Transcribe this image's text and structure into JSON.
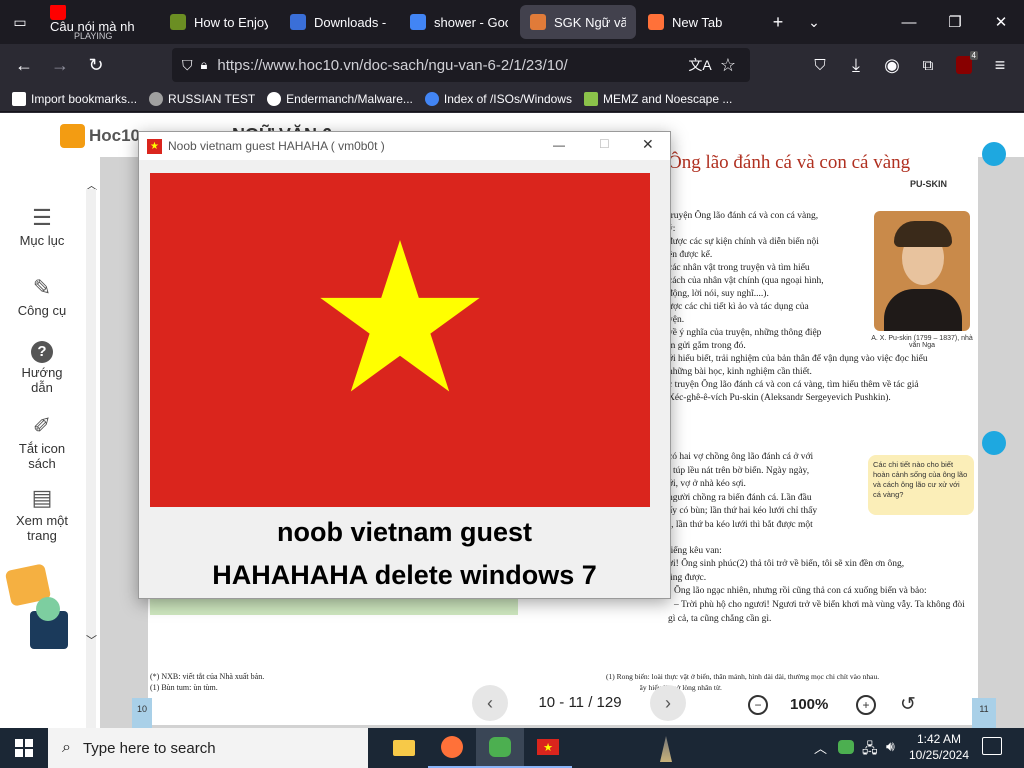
{
  "browser": {
    "tabs": [
      {
        "title": "Câu nói mà nh",
        "subtitle": "PLAYING",
        "favicon_color": "#ff0000",
        "active": false
      },
      {
        "title": "How to Enjoy",
        "favicon_color": "#6b8e23",
        "active": false
      },
      {
        "title": "Downloads - B",
        "favicon_color": "#3a6fd8",
        "active": false
      },
      {
        "title": "shower - Goog",
        "favicon_color": "#4285f4",
        "active": false
      },
      {
        "title": "SGK Ngữ vă",
        "favicon_color": "#e07b39",
        "active": true
      },
      {
        "title": "New Tab",
        "favicon_color": "#ff7139",
        "active": false
      }
    ],
    "url": "https://www.hoc10.vn/doc-sach/ngu-van-6-2/1/23/10/",
    "extensions_badge": "4",
    "bookmarks": [
      {
        "label": "Import bookmarks...",
        "icon": "import-icon"
      },
      {
        "label": "RUSSIAN TEST",
        "icon": "globe-icon"
      },
      {
        "label": "Endermanch/Malware...",
        "icon": "github-icon"
      },
      {
        "label": "Index of /ISOs/Windows",
        "icon": "google-icon"
      },
      {
        "label": "MEMZ and Noescape ...",
        "icon": "image-icon"
      }
    ]
  },
  "site": {
    "logo": "Hoc10",
    "header_title": "NGỮ VĂN 6",
    "sidebar": [
      {
        "label": "Mục lục",
        "icon": "menu-icon"
      },
      {
        "label": "Công cụ",
        "icon": "pencil-icon"
      },
      {
        "label": "Hướng dẫn",
        "icon": "help-icon"
      },
      {
        "label": "Tắt icon sách",
        "icon": "edit-icon"
      },
      {
        "label": "Xem một trang",
        "icon": "page-icon"
      }
    ],
    "book": {
      "title": "Ông lão đánh cá và con cá vàng",
      "author": "PU-SKIN",
      "portrait_caption": "A. X. Pu-skin (1799 – 1837), nhà văn Nga",
      "callout": "Các chi tiết nào cho biết hoàn cảnh sống của ông lão và cách ông lão cư xử với cá vàng?",
      "body_lines": [
        "truyện Ông lão đánh cá và con cá vàng,",
        "ý:",
        "được các sự kiện chính và diễn biến nội",
        "ện được kể.",
        "các nhân vật trong truyện và tìm hiểu",
        "cách của nhân vật chính (qua ngoại hình,",
        "động, lời nói, suy nghĩ....).",
        "ược các chi tiết kì ảo và tác dụng của",
        "yện.",
        "về ý nghĩa của truyện, những thông điệp",
        "m gửi gắm trong đó.",
        "ới hiểu biết, trải nghiệm của bản thân để vận dụng vào việc đọc hiểu",
        "những bài học, kinh nghiệm cần thiết.",
        "c truyện Ông lão đánh cá và con cá vàng, tìm hiểu thêm về tác giả",
        "Xéc-ghê-ê-vích Pu-skin (Aleksandr Sergeyevich Pushkin)."
      ],
      "story_lines": [
        "có hai vợ chồng ông lão đánh cá ở với",
        "t túp lều nát trên bờ biển. Ngày ngày,",
        "ới, vợ ở nhà kéo sợi.",
        "người chồng ra biển đánh cá. Lần đầu",
        "ấy có bùn; lần thứ hai kéo lưới chỉ thấy",
        "), lần thứ ba kéo lưới thì bắt được một",
        "tiếng kêu van:",
        "ơi! Ông sinh phúc(2) thả tôi trở về biển, tôi sẽ xin đền ơn ông,",
        "ũng được.",
        "Ông lão ngạc nhiên, nhưng rồi cũng thả con cá xuống biển và bảo:",
        "– Trời phù hộ cho ngươi! Ngươi trở về biển khơi mà vùng vẫy. Ta không đòi",
        "gì cả, ta cũng chẳng cần gì."
      ],
      "footnote_left_1": "(*) NXB: viết tắt của Nhà xuất bản.",
      "footnote_left_2": "(1) Bùn tum: ùn tùm.",
      "footnote_right_1": "(1) Rong biển: loài thực vật ở biển, thân mảnh, hình dài dài, thường mọc chi chít vào nhau.",
      "footnote_right_2": "ộ phúc, ở đây hiểu là mở lòng nhân từ.",
      "page_left": "10",
      "page_right": "11"
    },
    "pager": {
      "label": "10 - 11 / 129",
      "zoom": "100%"
    }
  },
  "dialog": {
    "title": "Noob vietnam guest HAHAHA ( vm0b0t )",
    "line1": "noob vietnam guest",
    "line2": "HAHAHAHA delete windows 7",
    "flag_red": "#da251d",
    "flag_star": "#ffff00"
  },
  "taskbar": {
    "search_placeholder": "Type here to search",
    "time": "1:42 AM",
    "date": "10/25/2024"
  }
}
